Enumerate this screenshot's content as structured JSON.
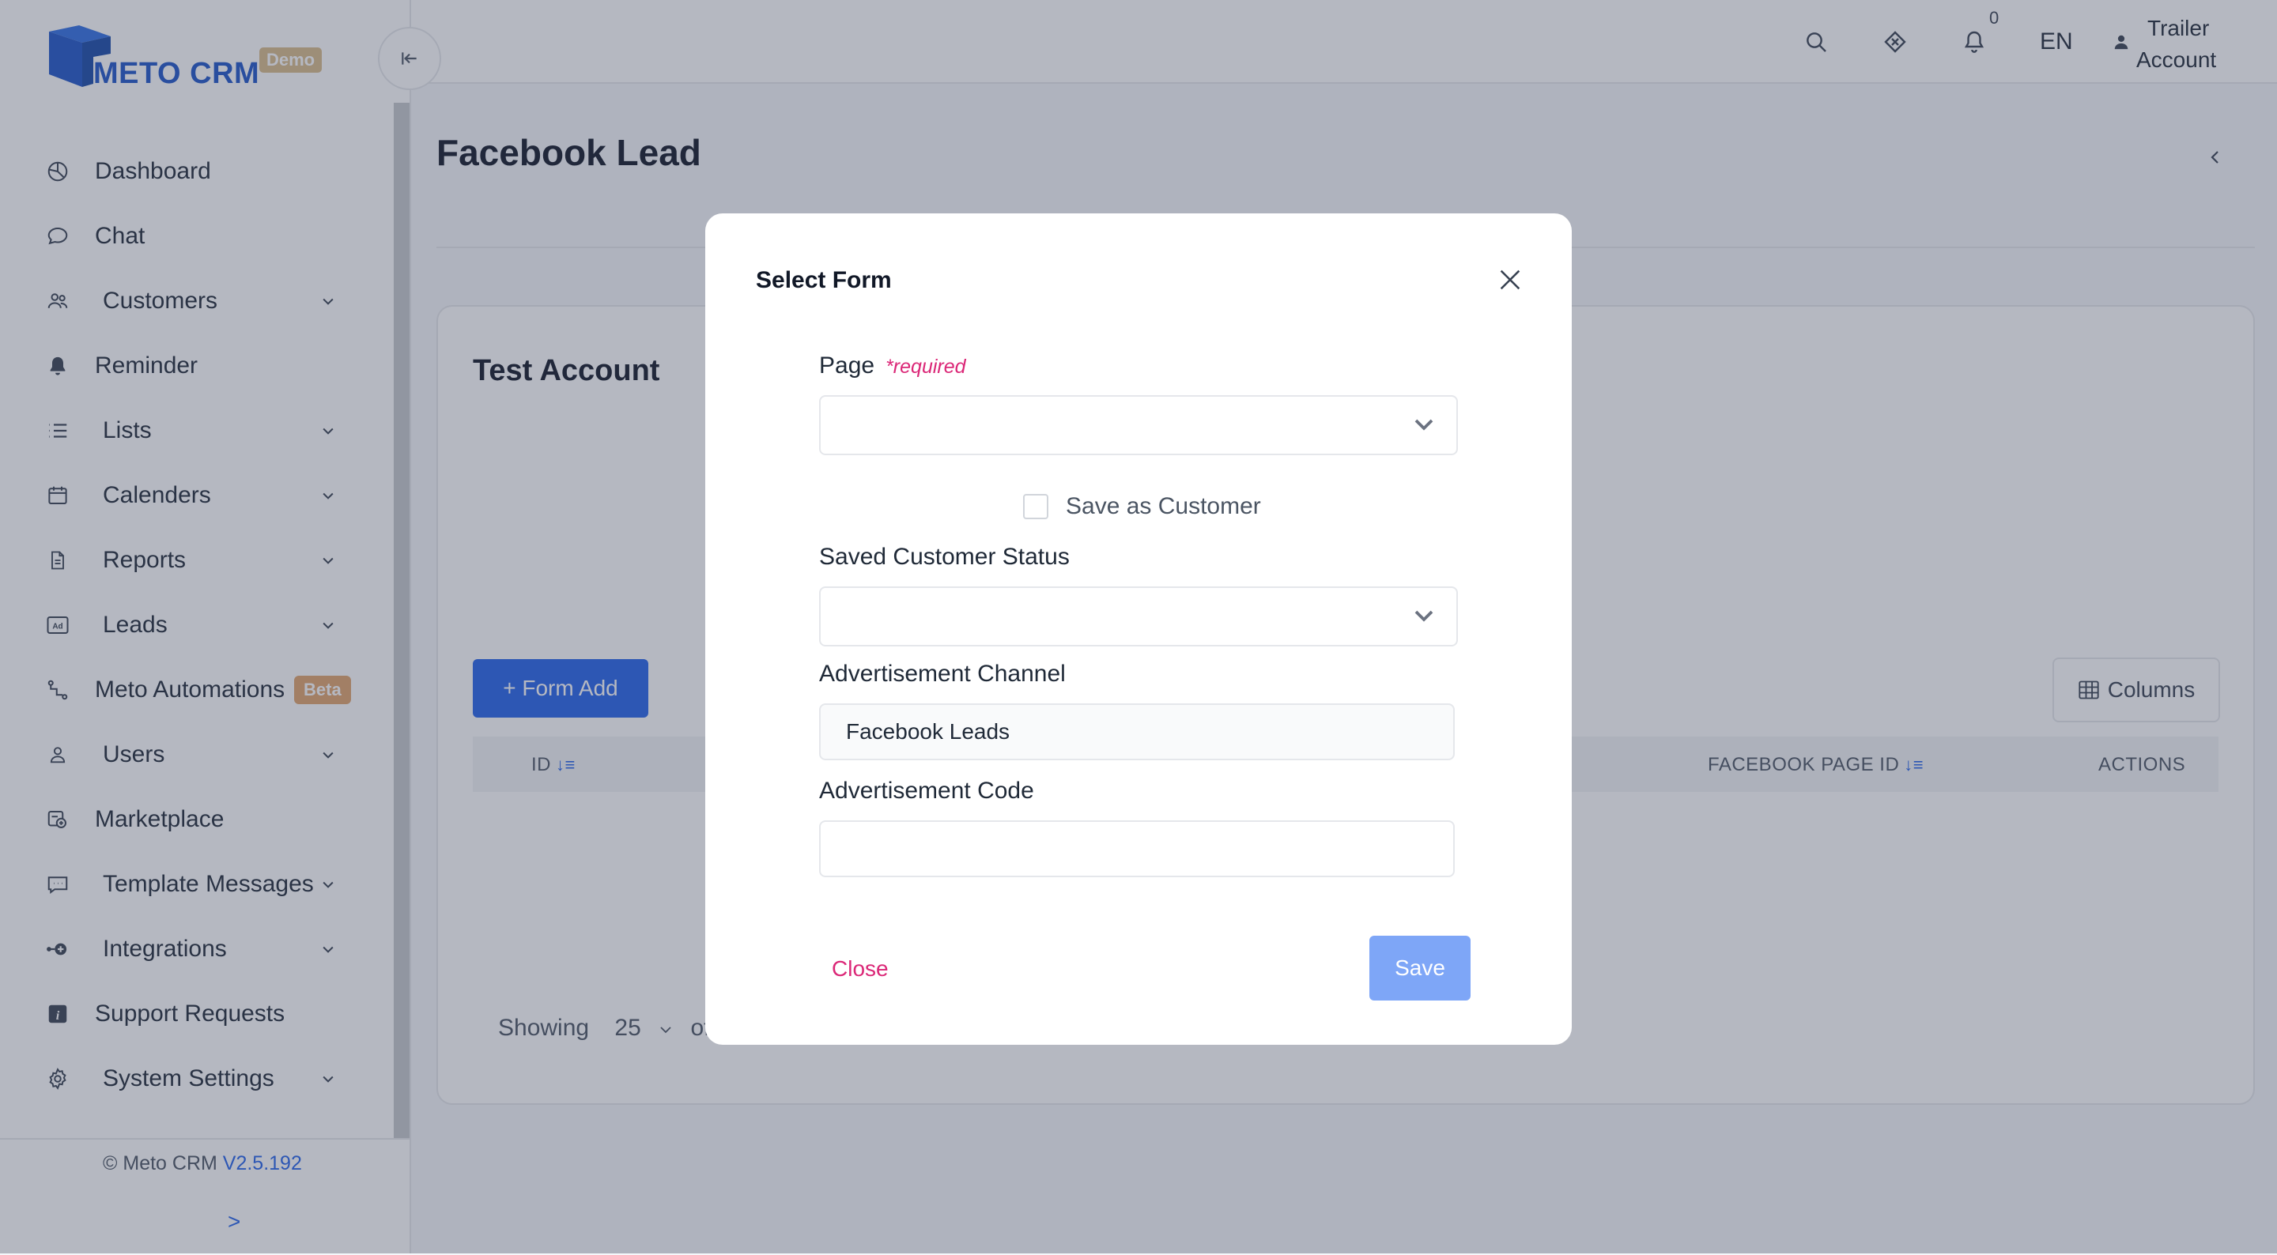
{
  "app": {
    "logo_text": "METO CRM",
    "logo_badge": "Demo",
    "brand_color": "#1e55c8",
    "accent_color": "#2563eb"
  },
  "sidebar": {
    "items": [
      {
        "label": "Dashboard",
        "icon": "pie-chart-icon",
        "has_chevron": false
      },
      {
        "label": "Chat",
        "icon": "chat-bubble-icon",
        "has_chevron": false
      },
      {
        "label": "Customers",
        "icon": "users-icon",
        "has_chevron": true
      },
      {
        "label": "Reminder",
        "icon": "bell-filled-icon",
        "has_chevron": false
      },
      {
        "label": "Lists",
        "icon": "list-icon",
        "has_chevron": true
      },
      {
        "label": "Calenders",
        "icon": "calendar-icon",
        "has_chevron": true
      },
      {
        "label": "Reports",
        "icon": "document-icon",
        "has_chevron": true
      },
      {
        "label": "Leads",
        "icon": "ad-icon",
        "has_chevron": true
      },
      {
        "label": "Meto Automations",
        "icon": "automation-icon",
        "has_chevron": false,
        "badge": "Beta"
      },
      {
        "label": "Users",
        "icon": "user-icon",
        "has_chevron": true
      },
      {
        "label": "Marketplace",
        "icon": "marketplace-icon",
        "has_chevron": false
      },
      {
        "label": "Template Messages",
        "icon": "message-template-icon",
        "has_chevron": true
      },
      {
        "label": "Integrations",
        "icon": "plug-icon",
        "has_chevron": true
      },
      {
        "label": "Support Requests",
        "icon": "info-square-icon",
        "has_chevron": false
      },
      {
        "label": "System Settings",
        "icon": "gear-icon",
        "has_chevron": true
      }
    ],
    "footer": {
      "copyright": "© Meto CRM",
      "version": "V2.5.192",
      "expand": ">"
    }
  },
  "header": {
    "notification_count": "0",
    "language": "EN",
    "user_line1": "Trailer",
    "user_line2": "Account"
  },
  "main": {
    "page_title": "Facebook Lead",
    "card_title": "Test Account",
    "form_add_label": "+ Form Add",
    "columns_label": "Columns",
    "table_headers": {
      "id": "ID",
      "facebook_page_id": "FACEBOOK PAGE ID",
      "actions": "ACTIONS"
    },
    "pagination": {
      "showing": "Showing",
      "per_page": "25",
      "of": "of"
    }
  },
  "modal": {
    "title": "Select Form",
    "page_label": "Page",
    "required_text": "*required",
    "page_value": "",
    "save_as_customer_label": "Save as Customer",
    "save_as_customer_checked": false,
    "saved_status_label": "Saved Customer Status",
    "saved_status_value": "",
    "ad_channel_label": "Advertisement Channel",
    "ad_channel_value": "Facebook Leads",
    "ad_code_label": "Advertisement Code",
    "ad_code_value": "",
    "close_label": "Close",
    "save_label": "Save"
  }
}
